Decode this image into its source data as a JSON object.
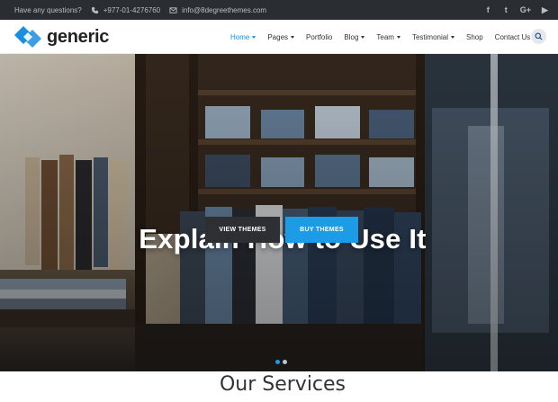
{
  "topbar": {
    "question": "Have any questions?",
    "phone": "+977-01-4276760",
    "email": "info@8degreethemes.com",
    "social": [
      {
        "icon": "facebook-icon",
        "glyph": "f"
      },
      {
        "icon": "twitter-icon",
        "glyph": "t"
      },
      {
        "icon": "google-plus-icon",
        "glyph": "G+"
      },
      {
        "icon": "youtube-icon",
        "glyph": "▶"
      }
    ]
  },
  "header": {
    "logo_text": "generic",
    "nav": [
      {
        "label": "Home",
        "has_dropdown": true,
        "active": true
      },
      {
        "label": "Pages",
        "has_dropdown": true,
        "active": false
      },
      {
        "label": "Portfolio",
        "has_dropdown": false,
        "active": false
      },
      {
        "label": "Blog",
        "has_dropdown": true,
        "active": false
      },
      {
        "label": "Team",
        "has_dropdown": true,
        "active": false
      },
      {
        "label": "Testimonial",
        "has_dropdown": true,
        "active": false
      },
      {
        "label": "Shop",
        "has_dropdown": false,
        "active": false
      },
      {
        "label": "Contact Us",
        "has_dropdown": false,
        "active": false
      }
    ]
  },
  "hero": {
    "title": "Explain How to Use It",
    "view_label": "VIEW THEMES",
    "buy_label": "BUY THEMES",
    "slide_count": 2,
    "active_slide": 1
  },
  "services": {
    "title": "Our Services"
  },
  "colors": {
    "accent": "#1c9be6",
    "topbar_bg": "#2a2e33",
    "dark_button": "#2d2f33"
  }
}
